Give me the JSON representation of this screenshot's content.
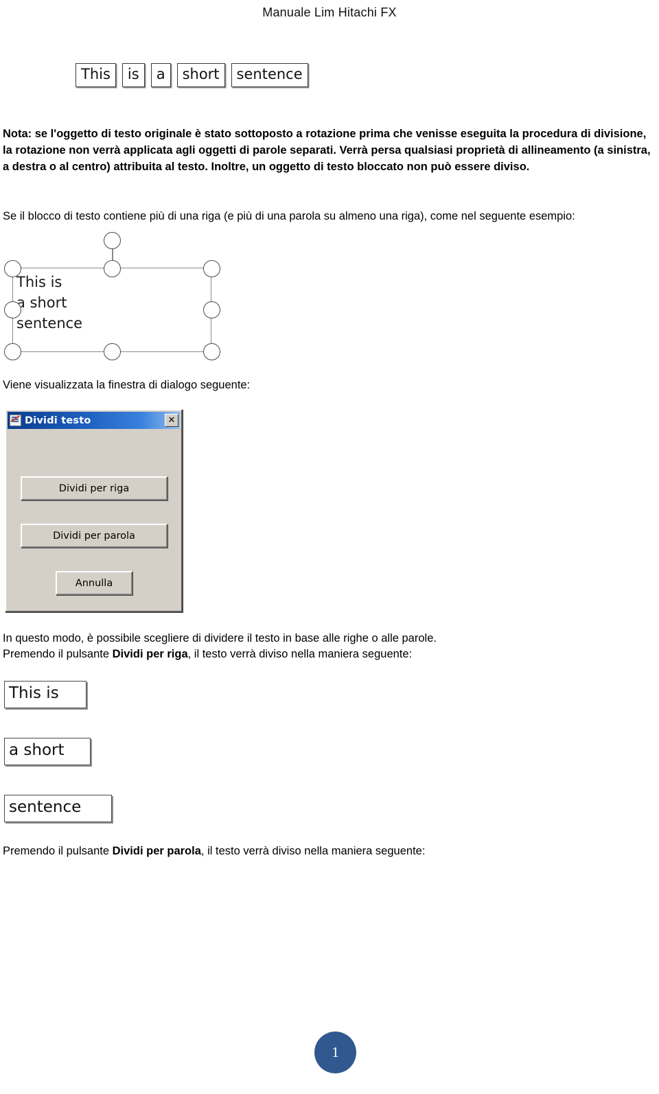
{
  "header": {
    "title": "Manuale Lim Hitachi FX"
  },
  "illustration_words": {
    "boxes": [
      "This",
      "is",
      "a",
      "short",
      "sentence"
    ]
  },
  "paragraphs": {
    "nota_prefix": "Nota: se l'oggetto di testo originale è stato sottoposto a rotazione prima che venisse eseguita la procedura di divisione, la rotazione non verrà applicata agli oggetti di parole separati. Verrà persa qualsiasi proprietà di allineamento (a sinistra, a destra o al centro) attribuita al testo. Inoltre, un oggetto di testo bloccato non può essere diviso.",
    "se_blocco": "Se il blocco di testo contiene più di una riga (e più di una parola su almeno una riga), come nel seguente esempio:",
    "viene_visualizzata": "Viene visualizzata la finestra di dialogo seguente:",
    "in_questo_modo": "In questo modo, è possibile scegliere di dividere il testo in base alle righe o alle parole.",
    "premendo_riga_1": "Premendo il pulsante ",
    "premendo_riga_bold": "Dividi per riga",
    "premendo_riga_2": ", il testo verrà diviso nella maniera seguente:",
    "premendo_parola_1": "Premendo il pulsante ",
    "premendo_parola_bold": "Dividi per parola",
    "premendo_parola_2": ", il testo verrà diviso nella maniera seguente:"
  },
  "selection": {
    "text_line_1": "This is",
    "text_line_2": "a short",
    "text_line_3": "sentence",
    "handle_count": 9
  },
  "dialog": {
    "title": "Dividi testo",
    "close_label": "✕",
    "buttons": [
      {
        "label": "Dividi per riga"
      },
      {
        "label": "Dividi per parola"
      },
      {
        "label": "Annulla"
      }
    ],
    "colors": {
      "face": "#d4d0c8",
      "title_start": "#0a3e8f",
      "title_end": "#94bdee"
    }
  },
  "result_lines": {
    "boxes": [
      "This is",
      "a short",
      "sentence"
    ]
  },
  "footer": {
    "page_number": "1",
    "badge_color": "#31598f"
  }
}
